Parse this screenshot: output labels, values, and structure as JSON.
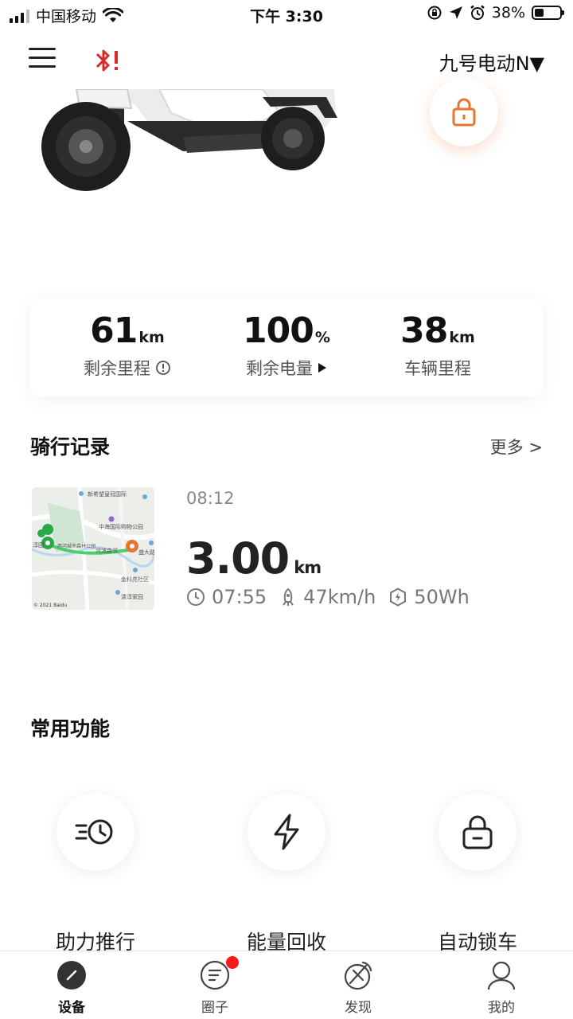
{
  "status_bar": {
    "carrier": "中国移动",
    "time": "下午 3:30",
    "battery": "38%",
    "battery_level": 0.38
  },
  "header": {
    "vehicle_name": "九号电动N▼"
  },
  "stats": [
    {
      "value": "61",
      "unit": "km",
      "label": "剩余里程"
    },
    {
      "value": "100",
      "unit": "%",
      "label": "剩余电量"
    },
    {
      "value": "38",
      "unit": "km",
      "label": "车辆里程"
    }
  ],
  "ride_section": {
    "title": "骑行记录",
    "more": "更多 >",
    "record": {
      "time": "08:12",
      "distance": "3.00",
      "distance_unit": "km",
      "duration": "07:55",
      "max_speed": "47km/h",
      "energy": "50Wh"
    },
    "map": {
      "labels": [
        "新希望皇冠国际",
        "中海国际购物公园",
        "两河城市森林公园",
        "河滨森邻",
        "盛大路",
        "金科苑社区",
        "清淳家园",
        "淳园"
      ],
      "copyright": "© 2021 Baidu"
    }
  },
  "functions_section": {
    "title": "常用功能",
    "items": [
      {
        "label": "助力推行",
        "icon": "push-assist-icon"
      },
      {
        "label": "能量回收",
        "icon": "lightning-icon"
      },
      {
        "label": "自动锁车",
        "icon": "auto-lock-icon"
      }
    ]
  },
  "tab_bar": {
    "tabs": [
      {
        "label": "设备",
        "icon": "device-icon",
        "active": true
      },
      {
        "label": "圈子",
        "icon": "community-icon",
        "badge": true
      },
      {
        "label": "发现",
        "icon": "discover-icon"
      },
      {
        "label": "我的",
        "icon": "profile-icon"
      }
    ]
  },
  "colors": {
    "accent_orange": "#e8742f",
    "bluetooth_red": "#d92b2b",
    "badge_red": "#ff1a1a"
  }
}
